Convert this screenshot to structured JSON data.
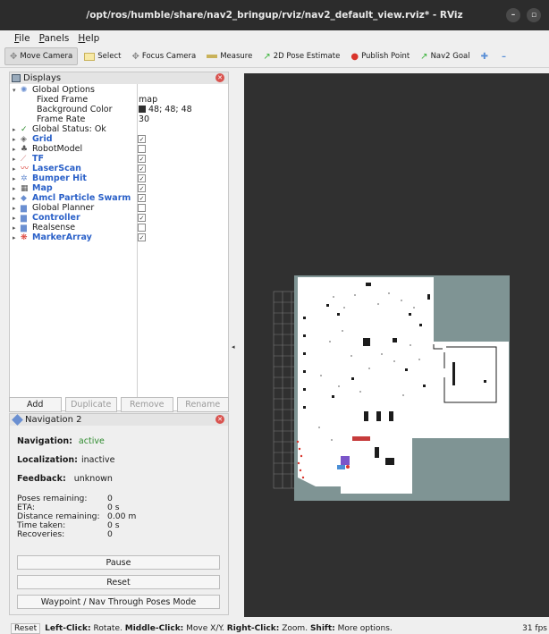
{
  "window": {
    "title": "/opt/ros/humble/share/nav2_bringup/rviz/nav2_default_view.rviz* - RViz"
  },
  "menu": {
    "file": "File",
    "panels": "Panels",
    "help": "Help"
  },
  "toolbar": {
    "move_camera": "Move Camera",
    "select": "Select",
    "focus_camera": "Focus Camera",
    "measure": "Measure",
    "pose_estimate": "2D Pose Estimate",
    "publish_point": "Publish Point",
    "nav2_goal": "Nav2 Goal"
  },
  "displays": {
    "title": "Displays",
    "global_options": "Global Options",
    "fixed_frame_label": "Fixed Frame",
    "fixed_frame_value": "map",
    "background_color_label": "Background Color",
    "background_color_value": "48; 48; 48",
    "frame_rate_label": "Frame Rate",
    "frame_rate_value": "30",
    "global_status": "Global Status: Ok",
    "items": [
      {
        "label": "Grid",
        "checked": true,
        "bold": true
      },
      {
        "label": "RobotModel",
        "checked": false,
        "bold": false
      },
      {
        "label": "TF",
        "checked": true,
        "bold": true
      },
      {
        "label": "LaserScan",
        "checked": true,
        "bold": true
      },
      {
        "label": "Bumper Hit",
        "checked": true,
        "bold": true
      },
      {
        "label": "Map",
        "checked": true,
        "bold": true
      },
      {
        "label": "Amcl Particle Swarm",
        "checked": true,
        "bold": true
      },
      {
        "label": "Global Planner",
        "checked": false,
        "bold": false
      },
      {
        "label": "Controller",
        "checked": true,
        "bold": true
      },
      {
        "label": "Realsense",
        "checked": false,
        "bold": false
      },
      {
        "label": "MarkerArray",
        "checked": true,
        "bold": true
      }
    ],
    "buttons": {
      "add": "Add",
      "duplicate": "Duplicate",
      "remove": "Remove",
      "rename": "Rename"
    }
  },
  "navigation": {
    "title": "Navigation 2",
    "navigation_label": "Navigation:",
    "navigation_value": "active",
    "localization_label": "Localization:",
    "localization_value": "inactive",
    "feedback_label": "Feedback:",
    "feedback_value": "unknown",
    "poses_remaining_label": "Poses remaining:",
    "poses_remaining_value": "0",
    "eta_label": "ETA:",
    "eta_value": "0 s",
    "distance_label": "Distance remaining:",
    "distance_value": "0.00 m",
    "time_taken_label": "Time taken:",
    "time_taken_value": "0 s",
    "recoveries_label": "Recoveries:",
    "recoveries_value": "0",
    "pause": "Pause",
    "reset": "Reset",
    "waypoint_mode": "Waypoint / Nav Through Poses Mode"
  },
  "status_bar": {
    "reset": "Reset",
    "left_click": "Left-Click:",
    "left_click_desc": "Rotate.",
    "middle_click": "Middle-Click:",
    "middle_click_desc": "Move X/Y.",
    "right_click": "Right-Click:",
    "right_click_desc": "Zoom.",
    "shift": "Shift:",
    "shift_desc": "More options.",
    "fps": "31 fps"
  }
}
